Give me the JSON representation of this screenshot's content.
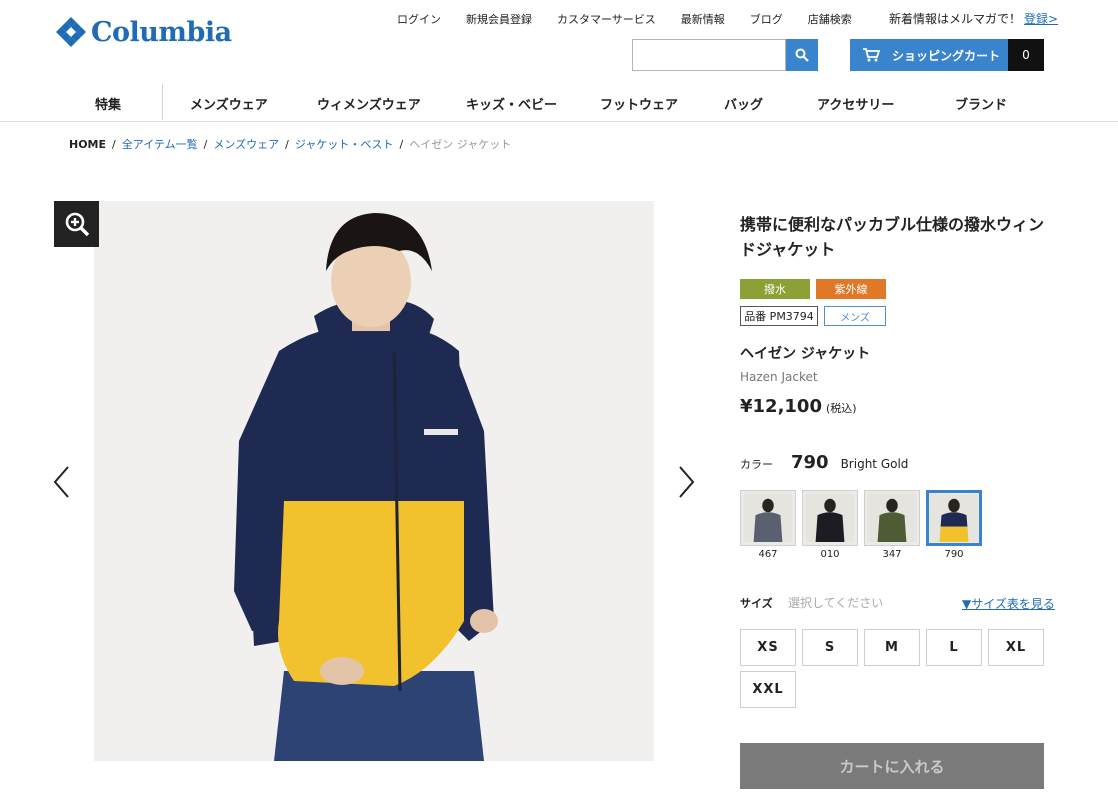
{
  "brand": {
    "name": "Columbia",
    "color": "#1f6bb5"
  },
  "top_links": [
    "ログイン",
    "新規会員登録",
    "カスタマーサービス",
    "最新情報",
    "ブログ",
    "店舗検索"
  ],
  "newsletter": {
    "text": "新着情報はメルマガで！",
    "link": "登録>"
  },
  "search": {
    "placeholder": "",
    "icon": "search-icon"
  },
  "cart": {
    "label": "ショッピングカート",
    "count": "0",
    "icon": "cart-icon"
  },
  "nav": [
    "特集",
    "メンズウェア",
    "ウィメンズウェア",
    "キッズ・ベビー",
    "フットウェア",
    "バッグ",
    "アクセサリー",
    "ブランド"
  ],
  "breadcrumb": {
    "home": "HOME",
    "links": [
      "全アイテム一覧",
      "メンズウェア",
      "ジャケット・ベスト"
    ],
    "current": "ヘイゼン ジャケット",
    "separator": "/"
  },
  "product": {
    "title": "携帯に便利なパッカブル仕様の撥水ウィンドジャケット",
    "tags": [
      {
        "label": "撥水",
        "color": "#8ba035"
      },
      {
        "label": "紫外線",
        "color": "#e07828"
      }
    ],
    "code": "品番 PM3794",
    "gender": "メンズ",
    "name_ja": "ヘイゼン ジャケット",
    "name_en": "Hazen Jacket",
    "price": "¥12,100",
    "tax": "(税込)"
  },
  "color": {
    "label": "カラー",
    "code": "790",
    "name": "Bright Gold",
    "swatches": [
      {
        "code": "467",
        "jacket": "#5a6070",
        "selected": false
      },
      {
        "code": "010",
        "jacket": "#1c1c22",
        "selected": false
      },
      {
        "code": "347",
        "jacket": "#4e5b34",
        "selected": false
      },
      {
        "code": "790",
        "jacket": "#1f2a52",
        "accent": "#f2c12e",
        "selected": true
      }
    ]
  },
  "size": {
    "label": "サイズ",
    "placeholder": "選択してください",
    "chart_link": "▼サイズ表を見る",
    "options": [
      "XS",
      "S",
      "M",
      "L",
      "XL",
      "XXL"
    ]
  },
  "add_to_cart": "カートに入れる",
  "colors": {
    "accent": "#3a83cd",
    "navy": "#1f2a52",
    "gold": "#f2c12e",
    "disabled": "#7a7a7a"
  }
}
